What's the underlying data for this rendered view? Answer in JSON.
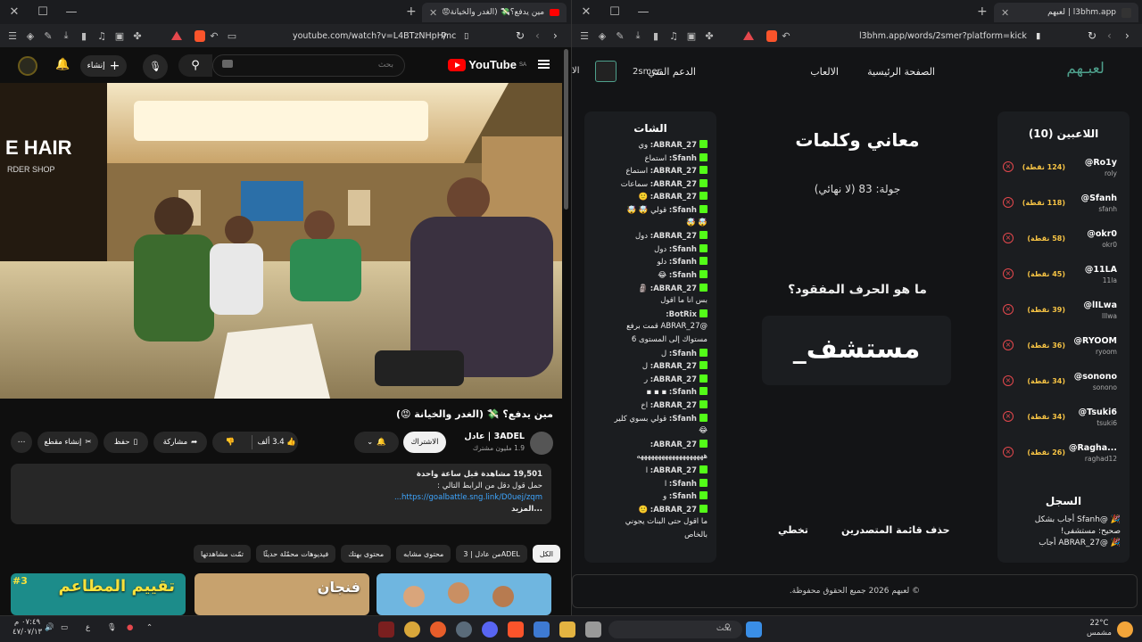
{
  "left_window": {
    "tab_title": "مين يدفع؟💸 (الغدر والخيانة😡",
    "url": "youtube.com/watch?v=L4BTzNHpHmc",
    "youtube": {
      "logo_text": "YouTube",
      "region": "SA",
      "search_placeholder": "بحث",
      "create_label": "إنشاء",
      "video_title": "مين يدفع؟ 💸 (الغدر والخيانة 😡)",
      "channel_name": "3ADEL | عادل",
      "subscribers": "1.9 مليون مشترك",
      "subscribe_label": "الاشتراك",
      "like_count": "3.4 ألف",
      "share_label": "مشاركة",
      "save_label": "حفظ",
      "clip_label": "إنشاء مقطع",
      "description": {
        "stats": "19,501 مشاهدة قبل ساعة واحدة",
        "line1": "حمل قول دقل من الرابط التالي :",
        "link": "https://goalbattle.sng.link/D0uej/zqm...",
        "more": "...المزيد"
      },
      "chips": [
        "الكل",
        "من عادل | 3ADEL",
        "محتوى مشابه",
        "محتوى بهتك",
        "فيديوهات محمّلة حديثًا",
        "تمّت مشاهدتها"
      ],
      "thumb_texts": [
        "تقييم المطاعم",
        "فنجان"
      ],
      "thumb_badge": "#3"
    }
  },
  "right_window": {
    "tab_title": "l3bhm.app | لعبهم",
    "url": "l3bhm.app/words/2smer?platform=kick",
    "nav": {
      "logo": "لعبـهم",
      "links": [
        "الصفحة الرئيسية",
        "الالعاب",
        "الدعم الفني"
      ],
      "user": "2smer",
      "cut_text": "الا"
    },
    "players_title": "اللاعبين (10)",
    "players": [
      {
        "name": "@Ro1y",
        "sub": "roly",
        "points": "(124 نقطة)"
      },
      {
        "name": "@Sfanh",
        "sub": "sfanh",
        "points": "(118 نقطة)"
      },
      {
        "name": "@okr0",
        "sub": "okr0",
        "points": "(58 نقطة)"
      },
      {
        "name": "@11LA",
        "sub": "11la",
        "points": "(45 نقطة)"
      },
      {
        "name": "@lILwa",
        "sub": "lllwa",
        "points": "(39 نقطة)"
      },
      {
        "name": "@RYOOM",
        "sub": "ryoom",
        "points": "(36 نقطة)"
      },
      {
        "name": "@sonono",
        "sub": "sonono",
        "points": "(34 نقطة)"
      },
      {
        "name": "@Tsuki6",
        "sub": "tsuki6",
        "points": "(34 نقطة)"
      },
      {
        "name": "@Ragha...",
        "sub": "raghad12",
        "points": "(26 نقطة)"
      }
    ],
    "log_title": "السجل",
    "log_lines": [
      "🎉 @Sfanh أجاب بشكل",
      "صحيح: مستشفى!",
      "🎉 @ABRAR_27 أجاب"
    ],
    "game_title": "معاني وكلمات",
    "round": "جولة: 83 (لا نهائي)",
    "question": "ما هو الحرف المفقود؟",
    "word": "مستشف_",
    "buttons": [
      "حذف قائمة المتصدرين",
      "تخطي"
    ],
    "chat_title": "الشات",
    "chat": [
      {
        "user": "ABRAR_27:",
        "msg": "وي"
      },
      {
        "user": "Sfanh:",
        "msg": "استماع"
      },
      {
        "user": "ABRAR_27:",
        "msg": "استماع"
      },
      {
        "user": "ABRAR_27:",
        "msg": "سماعات"
      },
      {
        "user": "ABRAR_27:",
        "msg": "🙂"
      },
      {
        "user": "Sfanh:",
        "msg": "قولي 🤯 🤯"
      },
      {
        "user": "",
        "msg": "🤯 🤯"
      },
      {
        "user": "ABRAR_27:",
        "msg": "دول"
      },
      {
        "user": "Sfanh:",
        "msg": "دول"
      },
      {
        "user": "Sfanh:",
        "msg": "دلو"
      },
      {
        "user": "Sfanh:",
        "msg": "😂"
      },
      {
        "user": "ABRAR_27:",
        "msg": "🗿"
      },
      {
        "user": "",
        "msg": "بس انا ما اقول"
      },
      {
        "user": "BotRix:",
        "msg": ""
      },
      {
        "user": "",
        "msg": "@ABRAR_27 قمت برفع"
      },
      {
        "user": "",
        "msg": "مستواك إلى المستوى 6"
      },
      {
        "user": "Sfanh:",
        "msg": "ل"
      },
      {
        "user": "ABRAR_27:",
        "msg": "ل"
      },
      {
        "user": "ABRAR_27:",
        "msg": "ر"
      },
      {
        "user": "Sfanh:",
        "msg": "▪ ▪ ▪"
      },
      {
        "user": "ABRAR_27:",
        "msg": "اخ"
      },
      {
        "user": "Sfanh:",
        "msg": "قولي بسوي كلير"
      },
      {
        "user": "",
        "msg": "😂"
      },
      {
        "user": "ABRAR_27:",
        "msg": ""
      },
      {
        "user": "",
        "msg": "هههههههههههههههههههه"
      },
      {
        "user": "ABRAR_27:",
        "msg": "ا"
      },
      {
        "user": "Sfanh:",
        "msg": "ا"
      },
      {
        "user": "Sfanh:",
        "msg": "و"
      },
      {
        "user": "ABRAR_27:",
        "msg": "🙂"
      },
      {
        "user": "",
        "msg": "ما اقول حتى البنات يجوني"
      },
      {
        "user": "",
        "msg": "بالخاص"
      }
    ],
    "footer": "© لعبهم 2026 جميع الحقوق محفوظة."
  },
  "taskbar": {
    "search_placeholder": "بحث",
    "temperature": "22°C",
    "weather": "مشمس",
    "time": "٠٧:٤٩ م",
    "date": "٤٧/٠٧/١٣",
    "lang": "ع"
  },
  "colors": {
    "kick_green": "#53fc18",
    "points_gold": "#f6c344",
    "remove_red": "#e5484d",
    "brand_teal": "#4ea08c",
    "yt_red": "#ff0000"
  }
}
